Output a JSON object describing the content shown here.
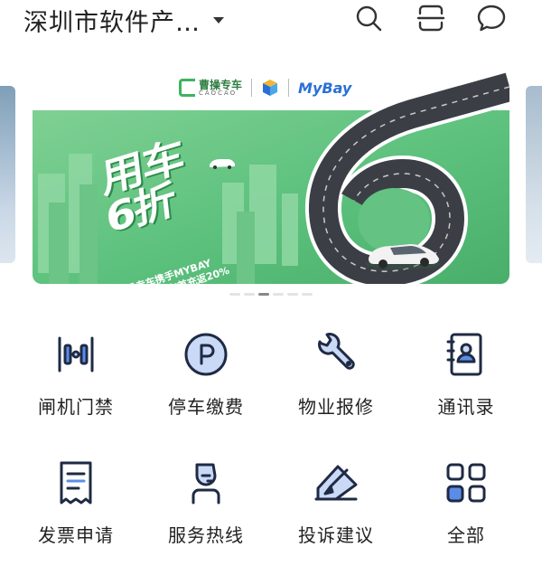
{
  "header": {
    "title": "深圳市软件产…",
    "icons": [
      "search-icon",
      "scan-icon",
      "message-icon"
    ]
  },
  "banner": {
    "logos": {
      "caocao_cn": "曹操专车",
      "caocao_en": "CAOCAO",
      "mybay": "MyBay"
    },
    "headline_1": "用车",
    "headline_2": "6折",
    "sub_1": "曹操专车携手MYBAY",
    "sub_2": "园区企业用车首充返20%",
    "page_count": 6,
    "active_page": 3
  },
  "services": [
    {
      "label": "闸机门禁",
      "icon": "gate-access-icon"
    },
    {
      "label": "停车缴费",
      "icon": "parking-icon"
    },
    {
      "label": "物业报修",
      "icon": "wrench-icon"
    },
    {
      "label": "通讯录",
      "icon": "contacts-book-icon"
    },
    {
      "label": "发票申请",
      "icon": "invoice-icon"
    },
    {
      "label": "服务热线",
      "icon": "hotline-agent-icon"
    },
    {
      "label": "投诉建议",
      "icon": "complaint-edit-icon"
    },
    {
      "label": "全部",
      "icon": "all-apps-icon"
    }
  ],
  "colors": {
    "icon_stroke": "#1f2a44",
    "icon_accent": "#5b8de8",
    "icon_accent_light": "#c9d9f6",
    "banner_green": "#5cc17d"
  }
}
